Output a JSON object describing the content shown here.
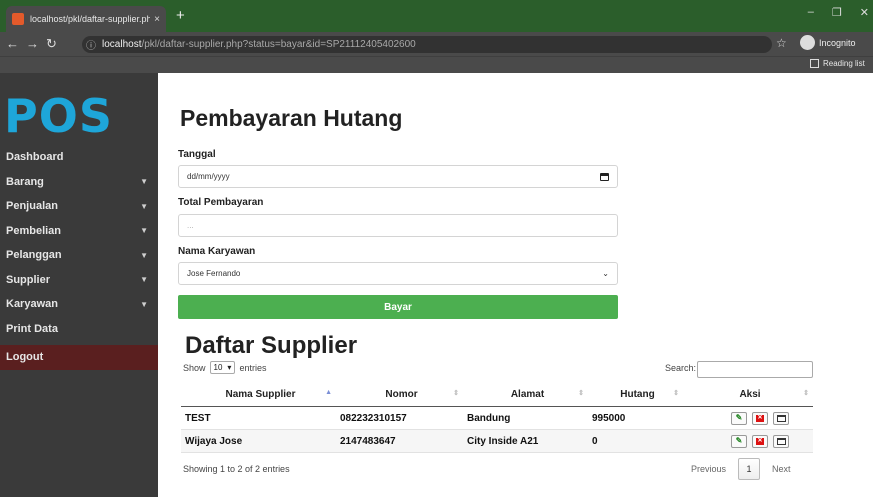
{
  "browser": {
    "tab_title": "localhost/pkl/daftar-supplier.php",
    "new_tab": "+",
    "tab_close": "×",
    "url_host": "localhost",
    "url_path": "/pkl/daftar-supplier.php?status=bayar&id=SP21112405402600",
    "incognito_label": "Incognito",
    "reading_list_label": "Reading list",
    "window_controls": {
      "minimize": "–",
      "restore": "❐",
      "close": "✕"
    },
    "colors": {
      "titlebar": "#2b5e2b",
      "toolbar": "#4a4a4a"
    }
  },
  "sidebar": {
    "logo": "POS",
    "items": [
      {
        "label": "Dashboard",
        "has_caret": false
      },
      {
        "label": "Barang",
        "has_caret": true
      },
      {
        "label": "Penjualan",
        "has_caret": true
      },
      {
        "label": "Pembelian",
        "has_caret": true
      },
      {
        "label": "Pelanggan",
        "has_caret": true
      },
      {
        "label": "Supplier",
        "has_caret": true
      },
      {
        "label": "Karyawan",
        "has_caret": true
      },
      {
        "label": "Print Data",
        "has_caret": false
      }
    ],
    "logout_label": "Logout",
    "colors": {
      "logo": "#1ea6d9",
      "logout_bg": "#5a1f1f"
    }
  },
  "form": {
    "title": "Pembayaran Hutang",
    "tanggal_label": "Tanggal",
    "tanggal_placeholder": "dd/mm/yyyy",
    "total_label": "Total Pembayaran",
    "total_placeholder": "...",
    "karyawan_label": "Nama Karyawan",
    "karyawan_selected": "Jose Fernando",
    "submit_label": "Bayar",
    "colors": {
      "submit": "#4caf50"
    }
  },
  "list": {
    "title": "Daftar Supplier",
    "show_label": "Show",
    "entries_value": "10",
    "entries_label": "entries",
    "search_label": "Search:",
    "columns": [
      "Nama Supplier",
      "Nomor",
      "Alamat",
      "Hutang",
      "Aksi"
    ],
    "rows": [
      {
        "nama": "TEST",
        "nomor": "082232310157",
        "alamat": "Bandung",
        "hutang": "995000"
      },
      {
        "nama": "Wijaya Jose",
        "nomor": "2147483647",
        "alamat": "City Inside A21",
        "hutang": "0"
      }
    ],
    "info": "Showing 1 to 2 of 2 entries",
    "pager": {
      "previous": "Previous",
      "current_page": "1",
      "next": "Next"
    }
  }
}
